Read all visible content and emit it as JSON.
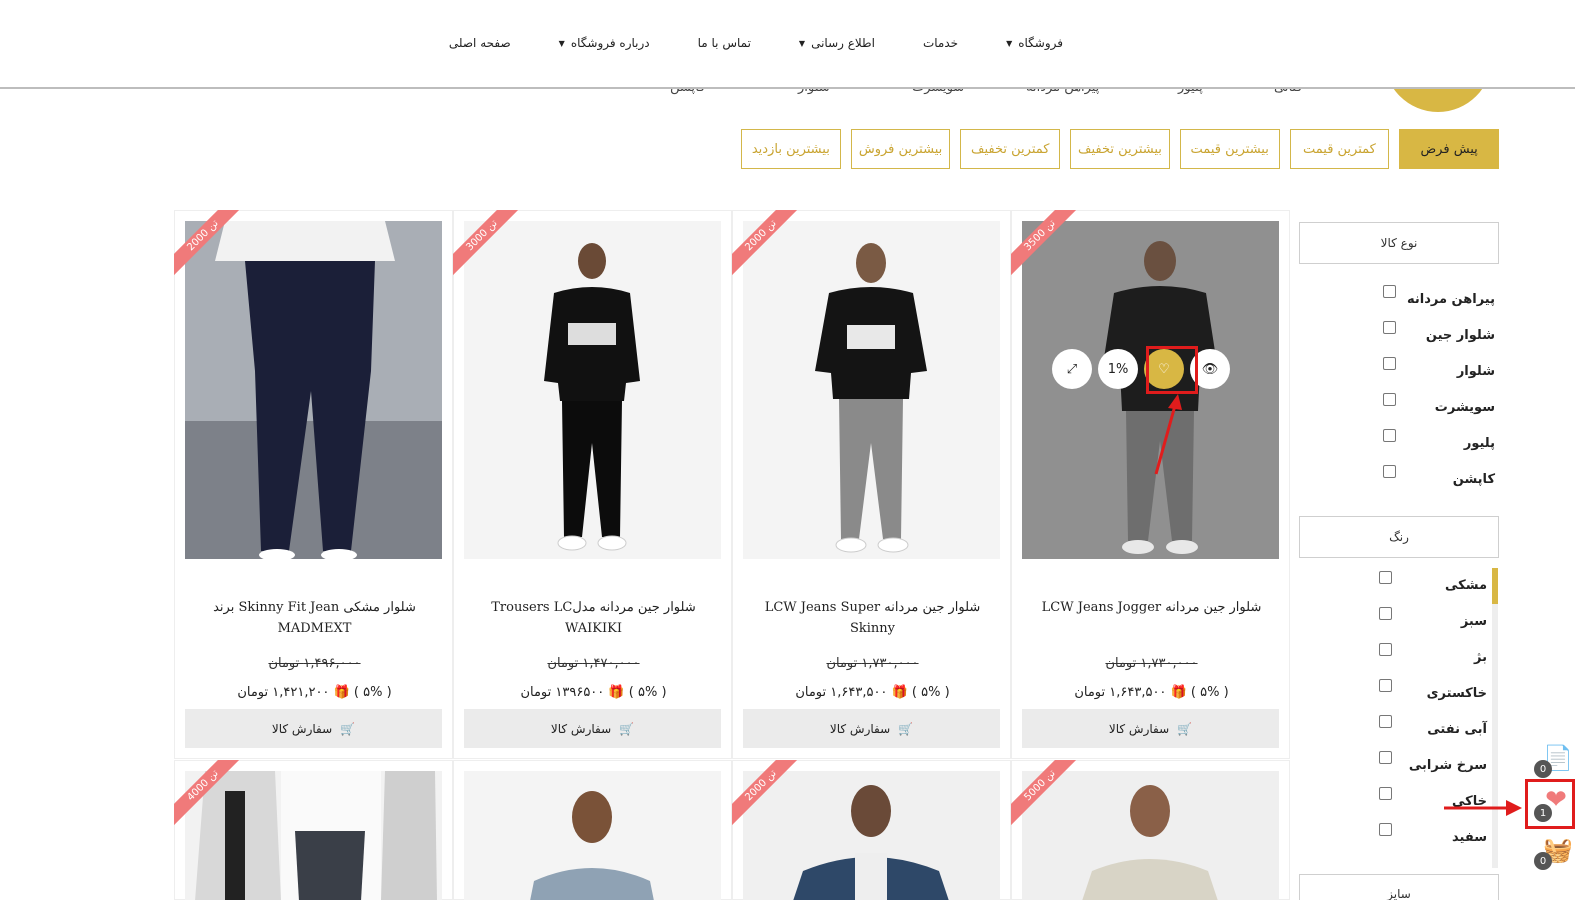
{
  "nav": {
    "items": [
      {
        "label": "صفحه اصلی",
        "has_caret": false
      },
      {
        "label": "درباره فروشگاه",
        "has_caret": true
      },
      {
        "label": "تماس با ما",
        "has_caret": false
      },
      {
        "label": "اطلاع رسانی",
        "has_caret": true
      },
      {
        "label": "خدمات",
        "has_caret": false
      },
      {
        "label": "فروشگاه",
        "has_caret": true
      }
    ]
  },
  "category_strip": [
    "کاپشن",
    "شلوار",
    "سویشرت",
    "پیراهن مردانه",
    "پلیور",
    "کتانی"
  ],
  "sort": {
    "buttons": [
      "پیش فرض",
      "کمترین قیمت",
      "بیشترین قیمت",
      "بیشترین تخفیف",
      "کمترین تخفیف",
      "بیشترین فروش",
      "بیشترین بازدید"
    ],
    "active_index": 0
  },
  "sidebar": {
    "type_title": "نوع کالا",
    "types": [
      "پیراهن مردانه",
      "شلوار جین",
      "شلوار",
      "سویشرت",
      "پلیور",
      "کاپشن"
    ],
    "color_title": "رنگ",
    "colors": [
      "مشکی",
      "سبز",
      "بژ",
      "خاکستری",
      "آبی نفتی",
      "سرخ شرابی",
      "خاکی",
      "سفید"
    ],
    "size_title": "سایز"
  },
  "products": [
    {
      "ribbon": "3500 تن",
      "title": "شلوار جین مردانه LCW Jeans Jogger",
      "old_price": "۱,۷۳۰,۰۰۰ تومان",
      "new_price": "۱,۶۴۳,۵۰۰ تومان",
      "discount": "( ۵% )",
      "order_label": "سفارش کالا"
    },
    {
      "ribbon": "2000 تن",
      "title": "شلوار جین مردانه LCW Jeans Super Skinny",
      "old_price": "۱,۷۳۰,۰۰۰ تومان",
      "new_price": "۱,۶۴۳,۵۰۰ تومان",
      "discount": "( ۵% )",
      "order_label": "سفارش کالا"
    },
    {
      "ribbon": "3000 تن",
      "title": "شلوار جین مردانه مدلTrousers LC WAIKIKI",
      "old_price": "۱,۴۷۰,۰۰۰ تومان",
      "new_price": "۱۳۹۶۵۰۰ تومان",
      "discount": "( ۵% )",
      "order_label": "سفارش کالا"
    },
    {
      "ribbon": "2000 تن",
      "title": "شلوار مشکی Skinny Fit Jean برند MADMEXT",
      "old_price": "۱,۴۹۶,۰۰۰ تومان",
      "new_price": "۱,۴۲۱,۲۰۰ تومان",
      "discount": "( ۵% )",
      "order_label": "سفارش کالا"
    }
  ],
  "row2_ribbons": [
    "5000 تن",
    "2000 تن",
    "",
    "4000 تن"
  ],
  "hover_icons": {
    "discount_label": "1%"
  },
  "floating": {
    "compare_count": "0",
    "wishlist_count": "1",
    "cart_count": "0"
  },
  "colors": {
    "accent": "#d8b744",
    "ribbon": "#f07a7a",
    "annotation": "#e01c1c"
  }
}
